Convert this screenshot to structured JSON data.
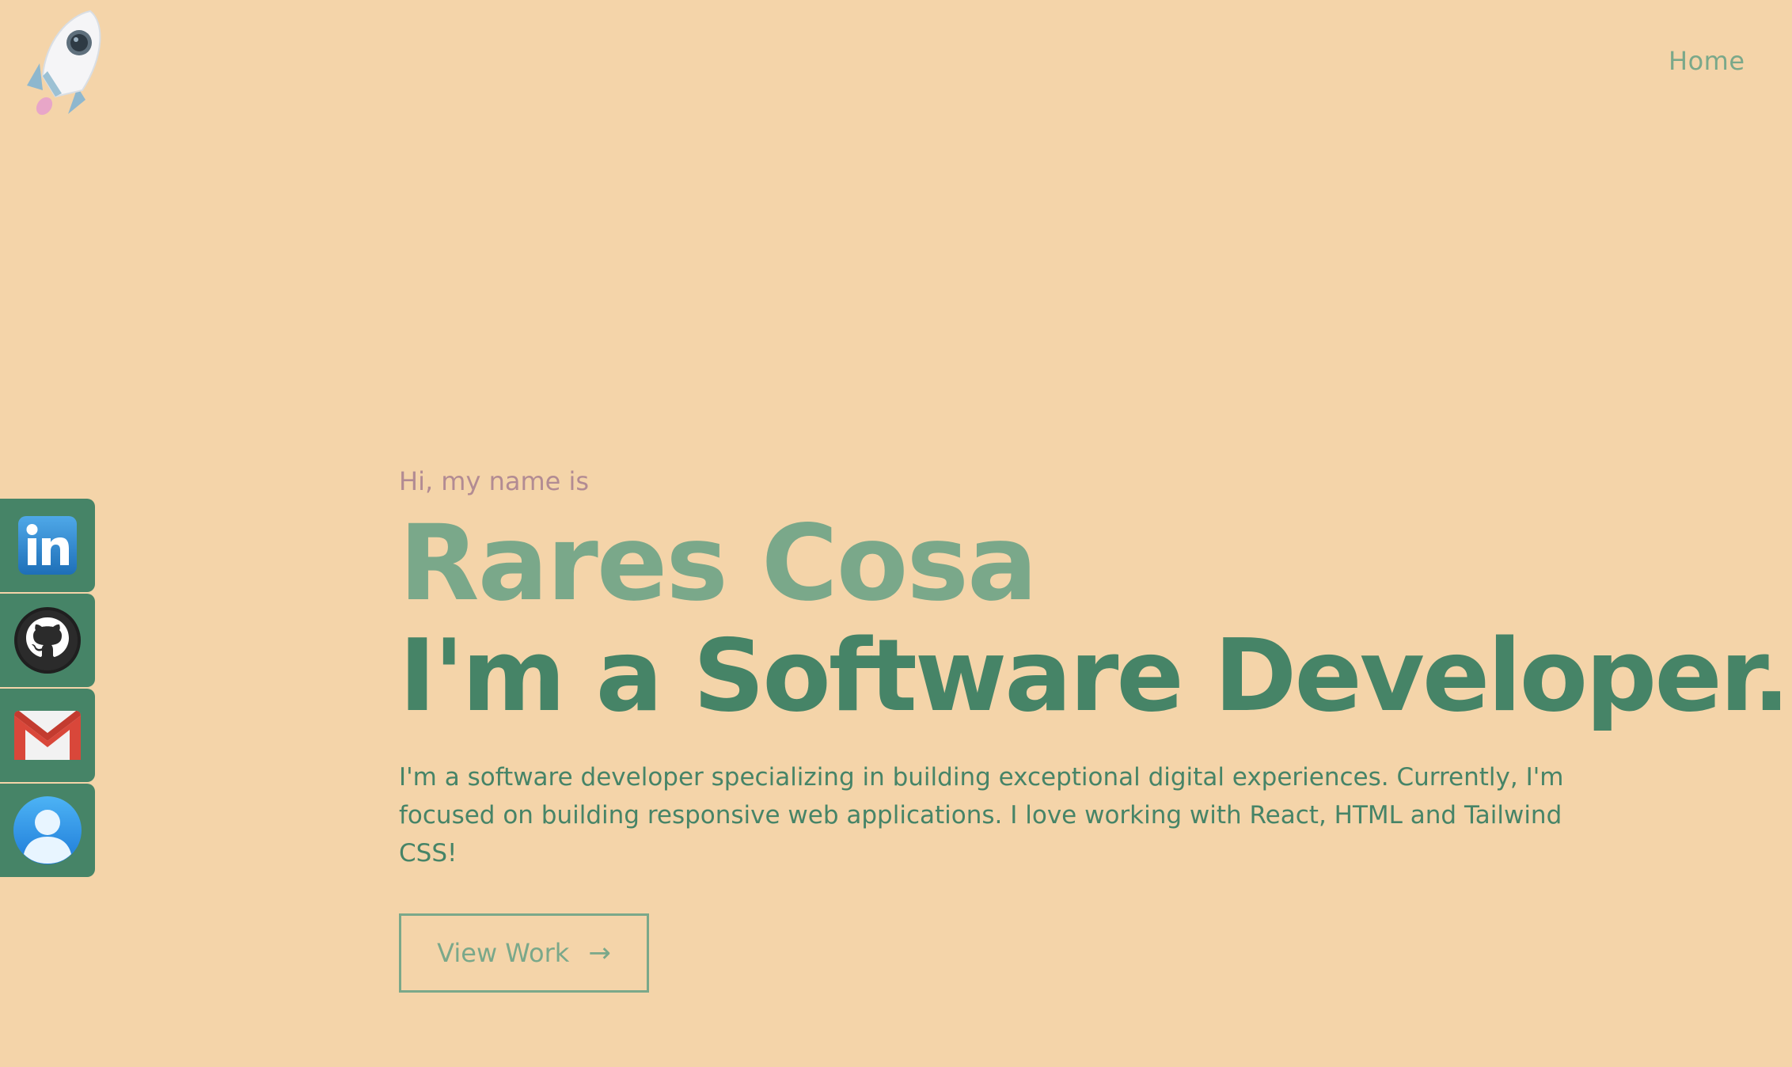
{
  "nav": {
    "items": [
      {
        "label": "Home"
      }
    ]
  },
  "social": {
    "items": [
      {
        "name": "linkedin",
        "icon": "linkedin-icon"
      },
      {
        "name": "github",
        "icon": "github-icon"
      },
      {
        "name": "gmail",
        "icon": "mail-icon"
      },
      {
        "name": "profile",
        "icon": "user-icon"
      }
    ]
  },
  "hero": {
    "intro": "Hi, my name is",
    "name": "Rares Cosa",
    "role": "I'm a Software Developer.",
    "description": "I'm a software developer specializing in building exceptional digital experiences. Currently, I'm focused on building responsive web applications. I love working with React, HTML and Tailwind CSS!",
    "cta_label": "View Work",
    "cta_arrow": "→"
  },
  "colors": {
    "background": "#F4D4A9",
    "accent_light": "#7AA88A",
    "accent_dark": "#468467",
    "intro": "#B28B93"
  }
}
